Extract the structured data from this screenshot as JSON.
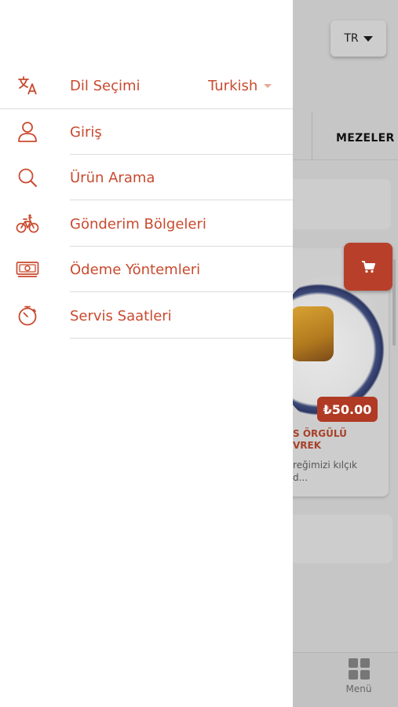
{
  "background": {
    "language_button": "TR",
    "category_label": "MEZELER",
    "product": {
      "price": "₺50.00",
      "title_line1": "S ÖRGÜLÜ",
      "title_line2": "VREK",
      "desc_line1": "reğimizi kılçık",
      "desc_line2": "d..."
    },
    "tabbar": {
      "menu_label": "Menü"
    }
  },
  "drawer": {
    "language": {
      "label": "Dil Seçimi",
      "value": "Turkish"
    },
    "items": [
      {
        "label": "Giriş",
        "icon": "user-icon"
      },
      {
        "label": "Ürün Arama",
        "icon": "search-icon"
      },
      {
        "label": "Gönderim Bölgeleri",
        "icon": "bicycle-icon"
      },
      {
        "label": "Ödeme Yöntemleri",
        "icon": "money-icon"
      },
      {
        "label": "Servis Saatleri",
        "icon": "timer-icon"
      }
    ]
  },
  "colors": {
    "accent": "#c94a2f",
    "price_bg": "#b03a23",
    "cart_bg": "#b8402a"
  }
}
